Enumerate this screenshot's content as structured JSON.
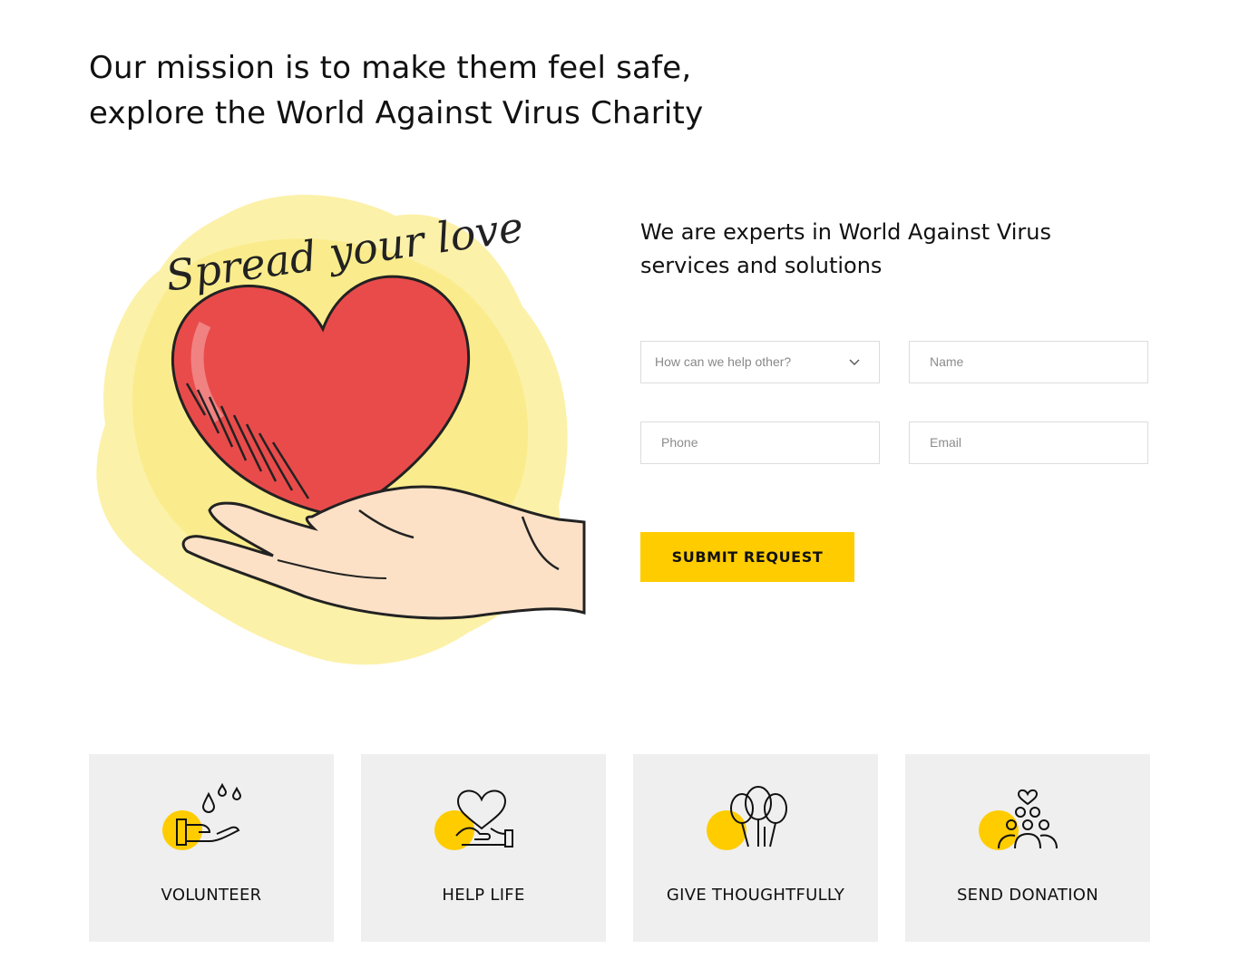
{
  "mission": {
    "line1": "Our mission is to make them feel safe,",
    "line2": "explore the World Against Virus Charity"
  },
  "illustration": {
    "caption": "Spread your love"
  },
  "form": {
    "heading_line1": "We are experts in World Against Virus",
    "heading_line2": "services and solutions",
    "help_select": "How can we help other?",
    "name_placeholder": "Name",
    "phone_placeholder": "Phone",
    "email_placeholder": "Email",
    "submit_label": "SUBMIT REQUEST"
  },
  "cards": [
    {
      "label": "VOLUNTEER",
      "icon": "volunteer-hand-drops-icon"
    },
    {
      "label": "HELP LIFE",
      "icon": "heart-in-hand-icon"
    },
    {
      "label": "GIVE THOUGHTFULLY",
      "icon": "balloons-icon"
    },
    {
      "label": "SEND DONATION",
      "icon": "community-heart-icon"
    }
  ],
  "colors": {
    "accent": "#ffcc00",
    "card_bg": "#efefef",
    "heart": "#e84c4c",
    "text": "#111111"
  }
}
